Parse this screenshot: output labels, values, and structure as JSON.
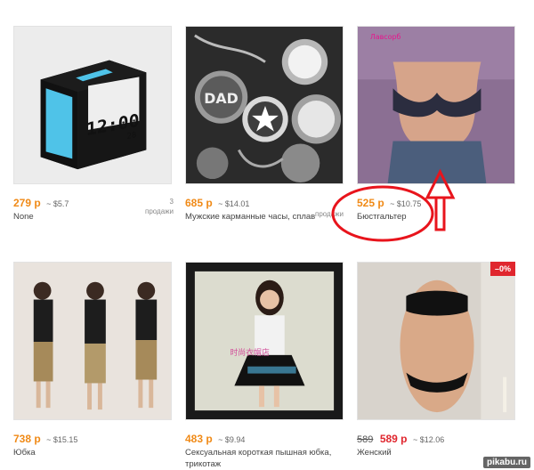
{
  "products": [
    {
      "id": "p1",
      "price": "279 р",
      "usd": "~ $5.7",
      "title": "None",
      "sold": "3\nпродажи"
    },
    {
      "id": "p2",
      "price": "685 р",
      "usd": "~ $14.01",
      "title": "Мужские карманные часы, сплав",
      "sold": ""
    },
    {
      "id": "p3",
      "price": "525 р",
      "usd": "~ $10.75",
      "title": "Бюстгальтер",
      "sold": "продажи"
    },
    {
      "id": "p4",
      "price": "738 р",
      "usd": "~ $15.15",
      "title": "Юбка",
      "sold": ""
    },
    {
      "id": "p5",
      "price": "483 р",
      "usd": "~ $9.94",
      "title": "Сексуальная короткая пышная юбка, трикотаж",
      "sold": ""
    },
    {
      "id": "p6",
      "old_price": "589",
      "price": "589 р",
      "usd": "~ $12.06",
      "title": "Женский",
      "sold": "",
      "badge": "–0%"
    }
  ],
  "image_text": {
    "clock_display": "12:00",
    "clock_small": "28",
    "dad_tag": "DAD",
    "logo_label": "Лавсорб",
    "photo_watermark": "时尚衣帽店"
  },
  "watermark": "pikabu.ru",
  "colors": {
    "price": "#f08a17",
    "sale": "#e0262e",
    "annotation": "#e8141c"
  }
}
